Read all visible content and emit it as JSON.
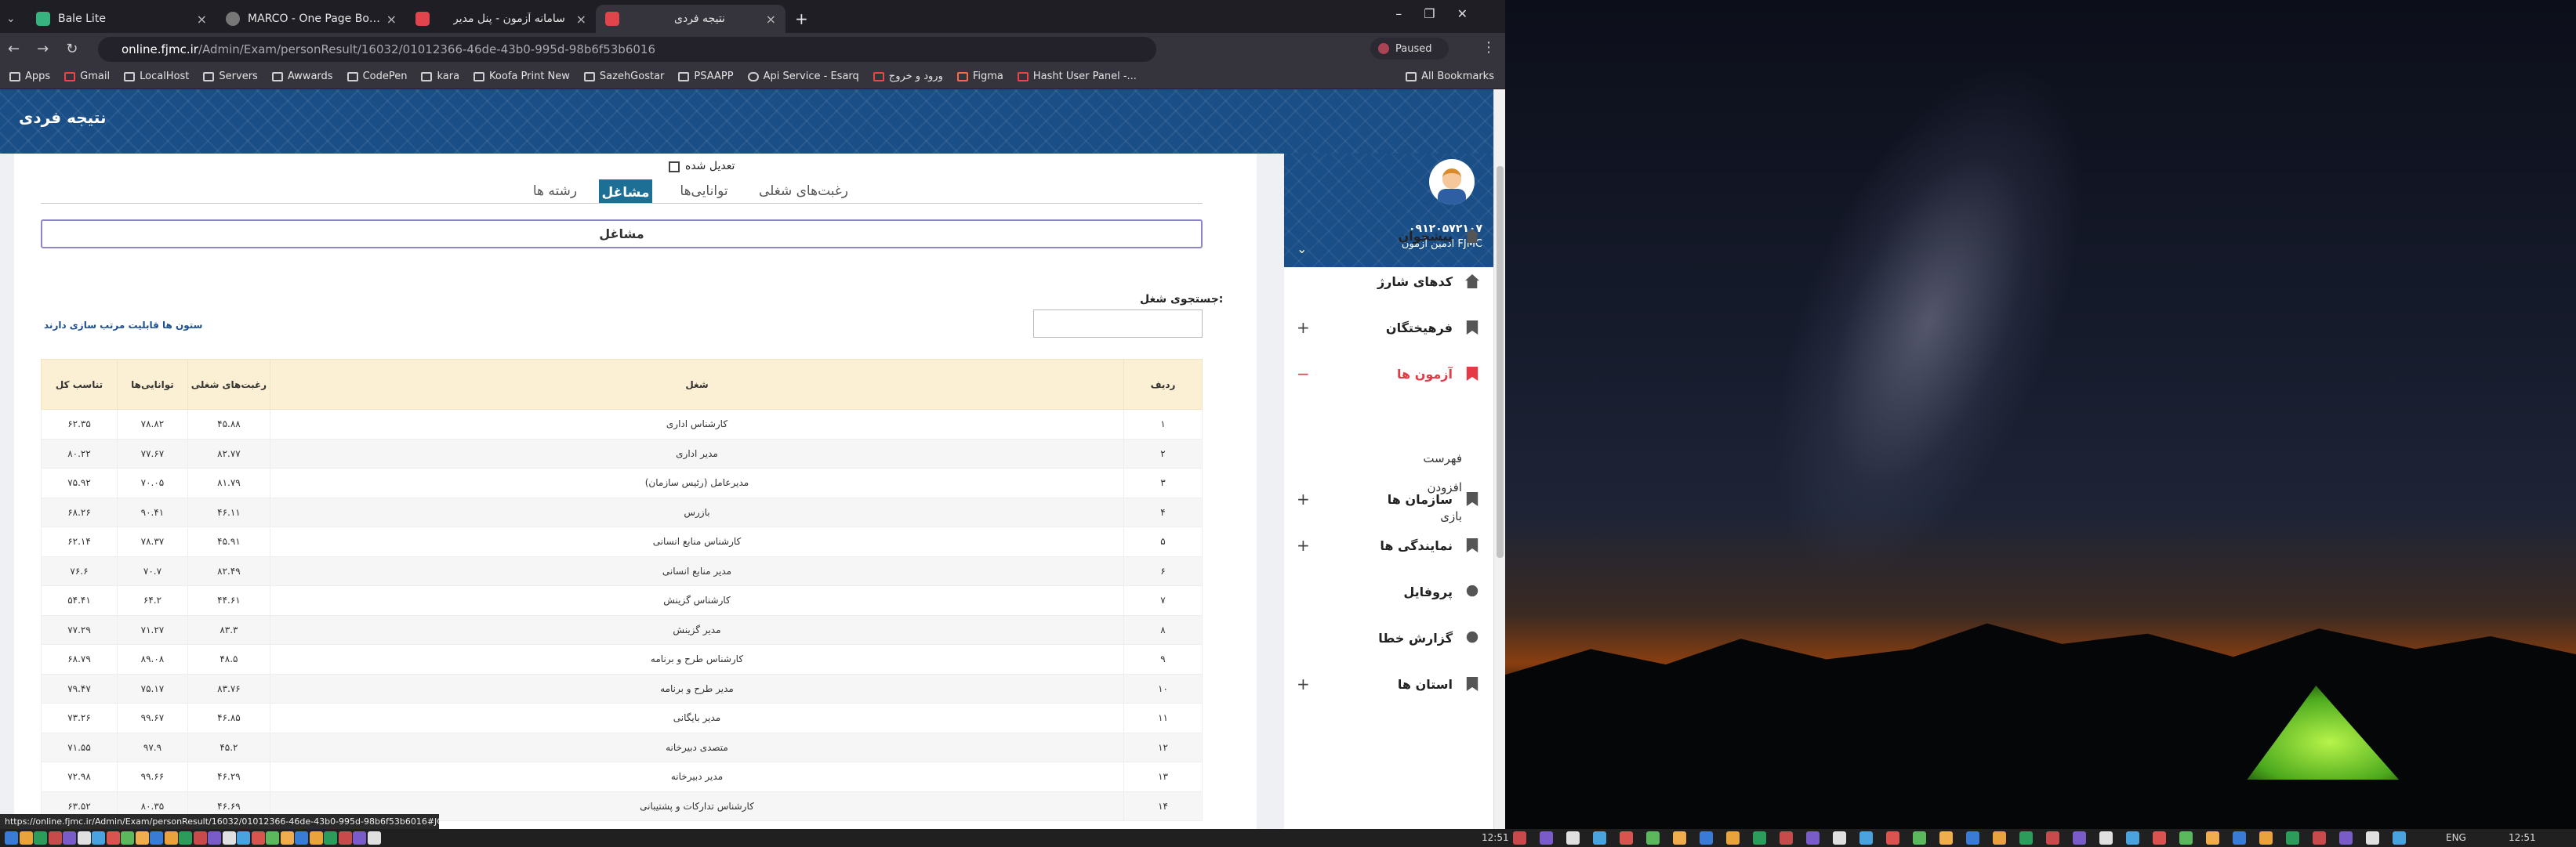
{
  "browser": {
    "tabs": [
      {
        "title": "Bale Lite",
        "color": "#36b37e"
      },
      {
        "title": "MARCO - One Page Bootstrap",
        "color": "#777777"
      },
      {
        "title": "سامانه آزمون - پنل مدیر",
        "color": "#e0454b"
      },
      {
        "title": "نتیجه فردی",
        "color": "#e0454b"
      }
    ],
    "url_host": "online.fjmc.ir",
    "url_path": "/Admin/Exam/personResult/16032/01012366-46de-43b0-995d-98b6f53b6016",
    "profile_status": "Paused",
    "bookmarks": [
      "Apps",
      "Gmail",
      "LocalHost",
      "Servers",
      "Awwards",
      "CodePen",
      "kara",
      "Koofa Print New",
      "SazehGostar",
      "PSAAPP",
      "Api Service - Esarq",
      "ورود و خروج",
      "Figma",
      "Hasht User Panel -..."
    ],
    "all_bookmarks": "All Bookmarks",
    "status_url": "https://online.fjmc.ir/Admin/Exam/personResult/16032/01012366-46de-43b0-995d-98b6f53b6016#JOBS"
  },
  "page": {
    "title": "نتیجه فردی",
    "adjusted_label": "تعدیل شده",
    "tabs": [
      "رغبت‌های شغلی",
      "توانایی‌ها",
      "مشاغل",
      "رشته ها"
    ],
    "active_tab": "مشاغل",
    "section_title": "مشاغل",
    "search_label": "جستجوی شغل:",
    "sortable_note": "ستون ها قابلیت مرتب سازی دارند",
    "table": {
      "headers": [
        "ردیف",
        "شغل",
        "رغبت‌های شغلی",
        "توانایی‌ها",
        "تناسب کل"
      ],
      "rows": [
        [
          "۱",
          "کارشناس اداری",
          "۴۵.۸۸",
          "۷۸.۸۲",
          "۶۲.۳۵"
        ],
        [
          "۲",
          "مدیر اداری",
          "۸۲.۷۷",
          "۷۷.۶۷",
          "۸۰.۲۲"
        ],
        [
          "۳",
          "مدیرعامل (رئیس سازمان)",
          "۸۱.۷۹",
          "۷۰.۰۵",
          "۷۵.۹۲"
        ],
        [
          "۴",
          "بازرس",
          "۴۶.۱۱",
          "۹۰.۴۱",
          "۶۸.۲۶"
        ],
        [
          "۵",
          "کارشناس منابع انسانی",
          "۴۵.۹۱",
          "۷۸.۳۷",
          "۶۲.۱۴"
        ],
        [
          "۶",
          "مدیر منابع انسانی",
          "۸۲.۴۹",
          "۷۰.۷",
          "۷۶.۶"
        ],
        [
          "۷",
          "کارشناس گزینش",
          "۴۴.۶۱",
          "۶۴.۲",
          "۵۴.۴۱"
        ],
        [
          "۸",
          "مدیر گزینش",
          "۸۳.۳",
          "۷۱.۲۷",
          "۷۷.۲۹"
        ],
        [
          "۹",
          "کارشناس طرح و برنامه",
          "۴۸.۵",
          "۸۹.۰۸",
          "۶۸.۷۹"
        ],
        [
          "۱۰",
          "مدیر طرح و برنامه",
          "۸۳.۷۶",
          "۷۵.۱۷",
          "۷۹.۴۷"
        ],
        [
          "۱۱",
          "مدیر بایگانی",
          "۴۶.۸۵",
          "۹۹.۶۷",
          "۷۳.۲۶"
        ],
        [
          "۱۲",
          "متصدی دبیرخانه",
          "۴۵.۲",
          "۹۷.۹",
          "۷۱.۵۵"
        ],
        [
          "۱۳",
          "مدیر دبیرخانه",
          "۴۶.۲۹",
          "۹۹.۶۶",
          "۷۲.۹۸"
        ],
        [
          "۱۴",
          "کارشناس تدارکات و پشتیبانی",
          "۴۶.۶۹",
          "۸۰.۳۵",
          "۶۳.۵۲"
        ]
      ]
    }
  },
  "sidebar": {
    "user_phone": "۰۹۱۲۰۵۷۲۱۰۷",
    "user_name": "ادمین آزمون FJMC",
    "items": [
      {
        "label": "پیشخوان",
        "toggle": ""
      },
      {
        "label": "کدهای شارژ",
        "toggle": ""
      },
      {
        "label": "فرهیختگان",
        "toggle": "+"
      },
      {
        "label": "آزمون ها",
        "toggle": "−"
      },
      {
        "label": "سازمان ها",
        "toggle": "+"
      },
      {
        "label": "نمایندگی ها",
        "toggle": "+"
      },
      {
        "label": "پروفایل",
        "toggle": ""
      },
      {
        "label": "گزارش خطا",
        "toggle": ""
      },
      {
        "label": "استان ها",
        "toggle": "+"
      }
    ],
    "submenu": [
      "فهرست",
      "افزودن",
      "بازی"
    ],
    "active_color": "#e53946"
  },
  "taskbar": {
    "time": "12:51",
    "lang": "ENG"
  }
}
